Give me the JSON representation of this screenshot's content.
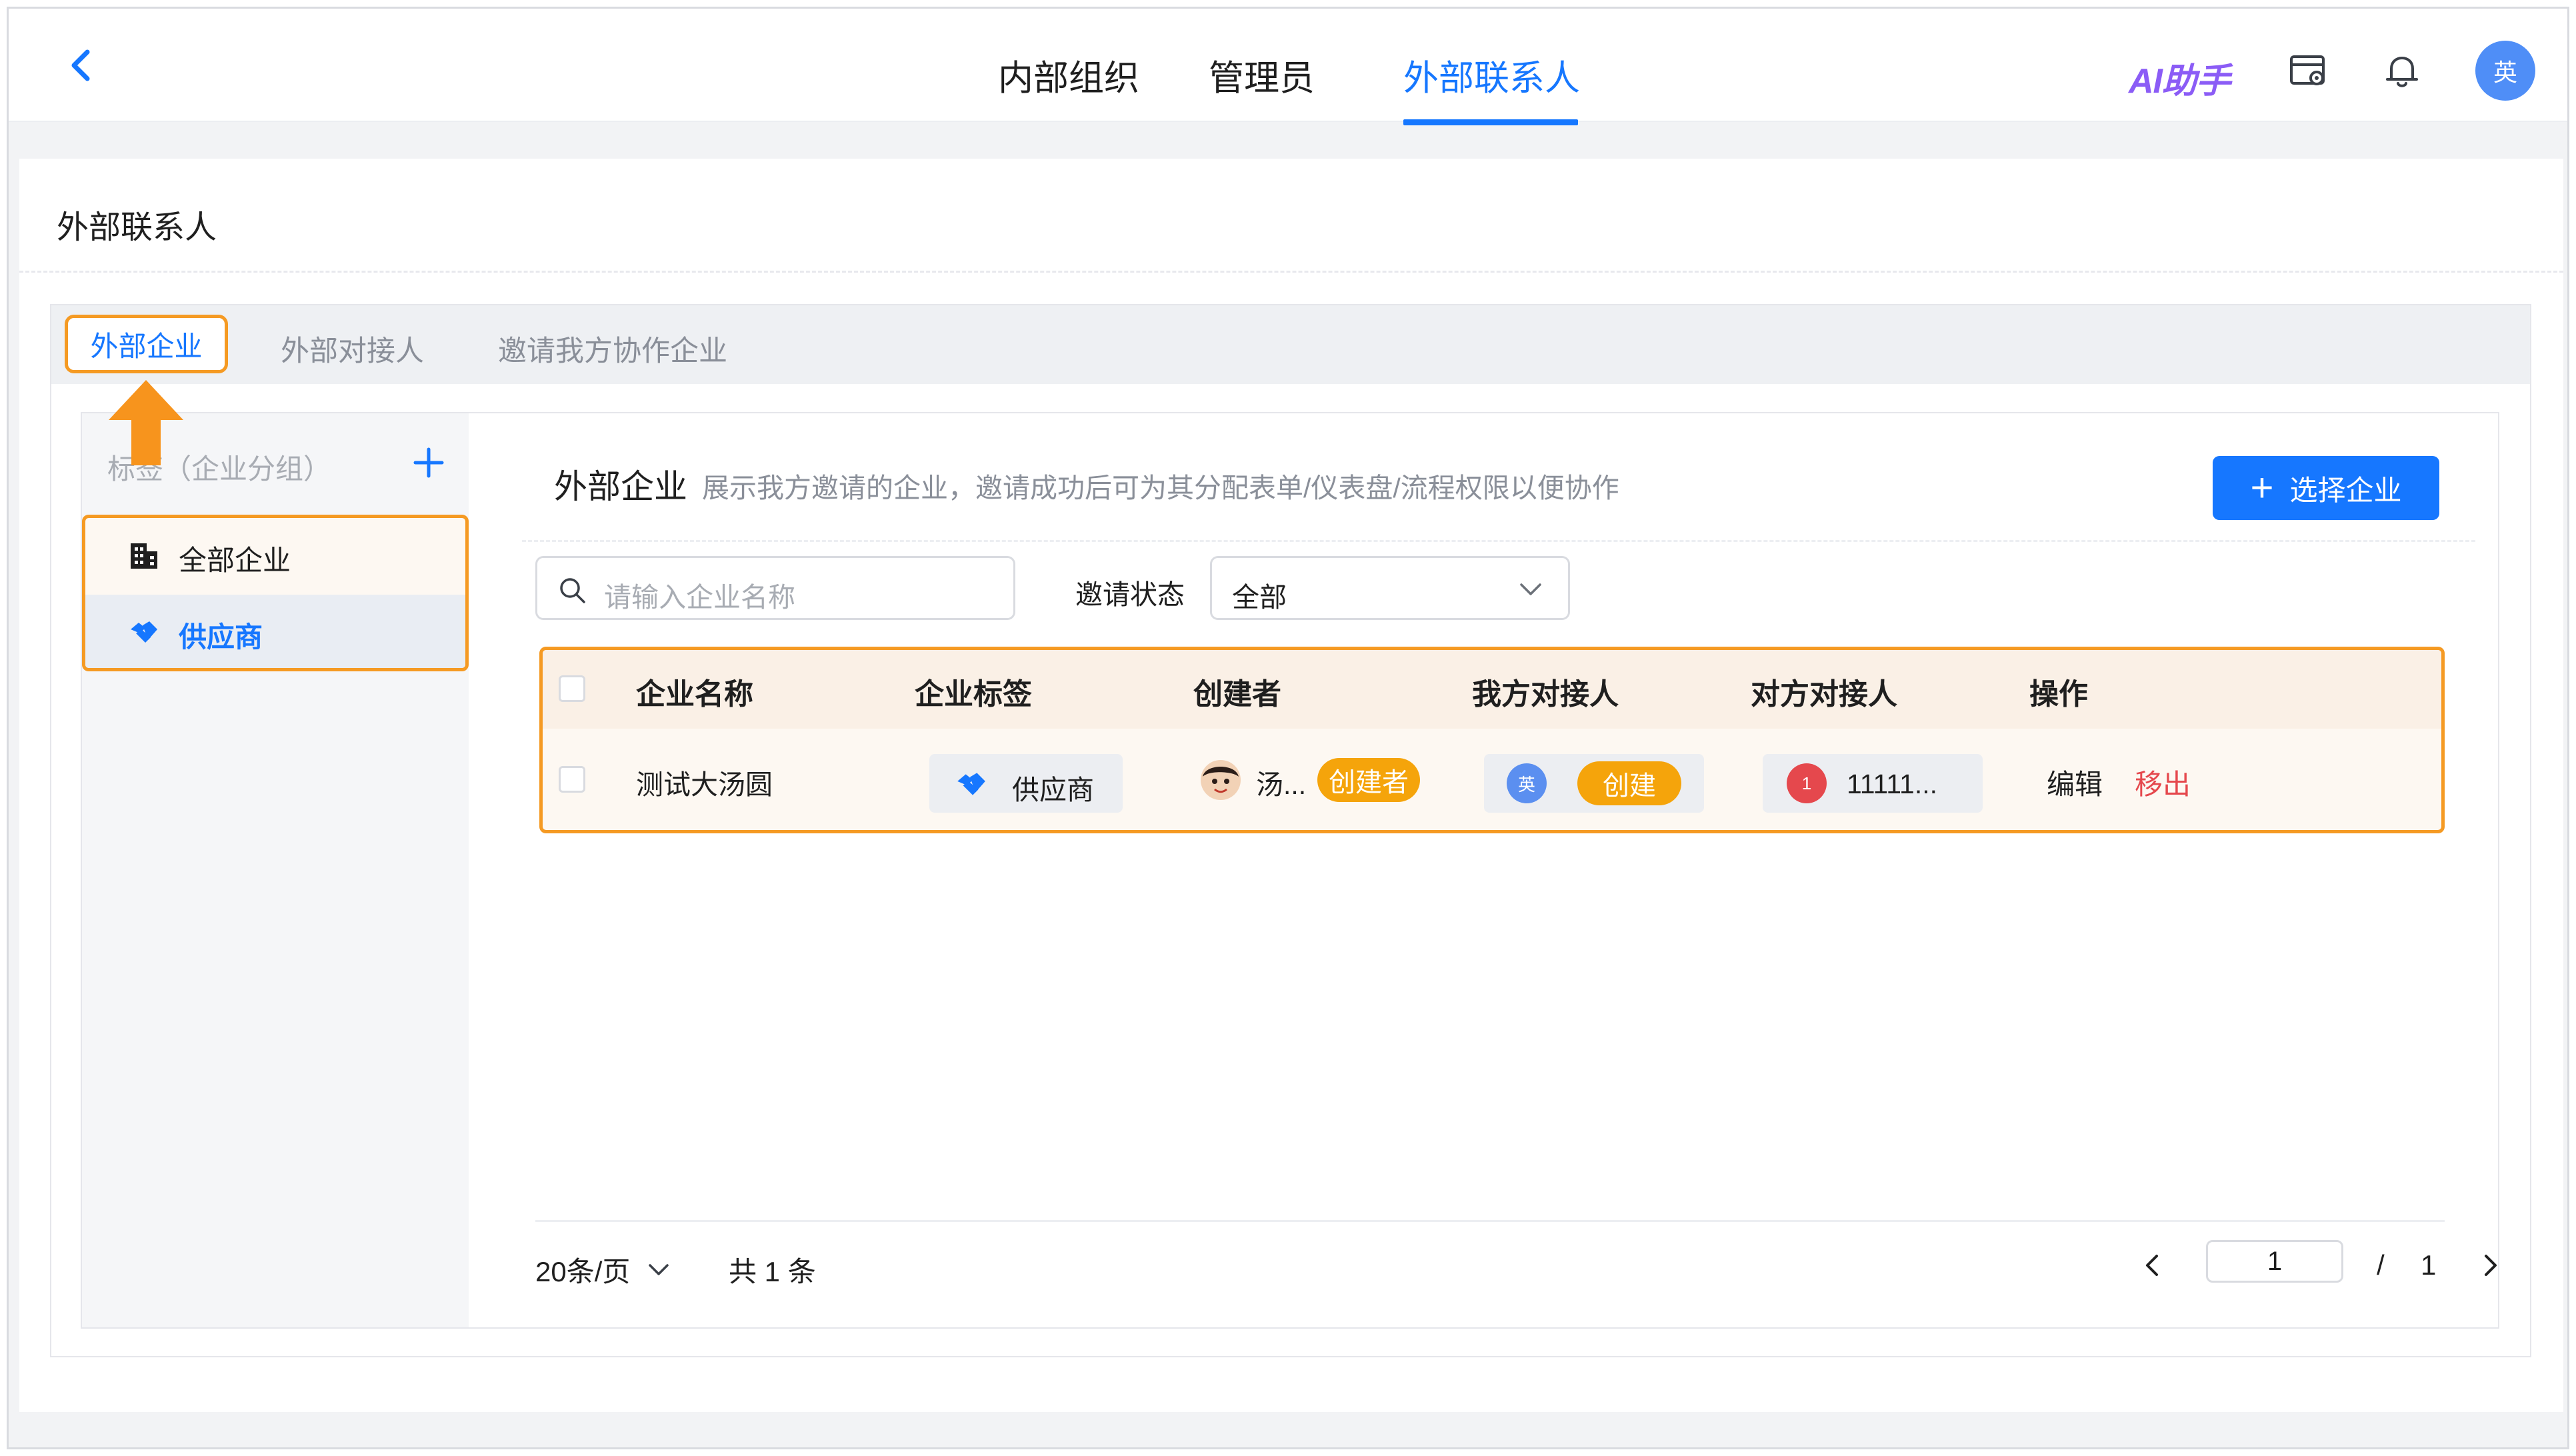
{
  "topbar": {
    "tabs": [
      {
        "label": "内部组织",
        "active": false
      },
      {
        "label": "管理员",
        "active": false
      },
      {
        "label": "外部联系人",
        "active": true
      }
    ],
    "ai_label_a": "AI",
    "ai_label_b": "助手",
    "avatar_text": "英",
    "icons": [
      "back-arrow-icon",
      "admin-console-icon",
      "bell-icon"
    ]
  },
  "page": {
    "title": "外部联系人",
    "tabs": [
      {
        "label": "外部企业",
        "active": true
      },
      {
        "label": "外部对接人",
        "active": false
      },
      {
        "label": "邀请我方协作企业",
        "active": false
      }
    ]
  },
  "sidebar": {
    "header": "标签（企业分组）",
    "items": [
      {
        "label": "全部企业",
        "icon": "building-icon",
        "selected": false
      },
      {
        "label": "供应商",
        "icon": "handshake-icon",
        "selected": true
      }
    ]
  },
  "section": {
    "title": "外部企业",
    "description": "展示我方邀请的企业，邀请成功后可为其分配表单/仪表盘/流程权限以便协作",
    "select_button": "选择企业"
  },
  "filters": {
    "search_placeholder": "请输入企业名称",
    "status_label": "邀请状态",
    "status_value": "全部"
  },
  "table": {
    "columns": [
      "企业名称",
      "企业标签",
      "创建者",
      "我方对接人",
      "对方对接人",
      "操作"
    ],
    "rows": [
      {
        "name": "测试大汤圆",
        "tag": "供应商",
        "creator": "汤...",
        "creator_badge": "创建者",
        "our_contact_avatar": "英",
        "our_contact_badge": "创建",
        "their_contact_avatar": "1",
        "their_contact": "11111...",
        "actions": [
          "编辑",
          "移出"
        ]
      }
    ]
  },
  "pagination": {
    "page_size": "20条/页",
    "total": "共 1 条",
    "current": "1",
    "separator": "/",
    "pages": "1"
  },
  "colors": {
    "primary": "#1677ff",
    "highlight": "#f59a23",
    "badge": "#f5a40b",
    "danger": "#e5484d"
  }
}
